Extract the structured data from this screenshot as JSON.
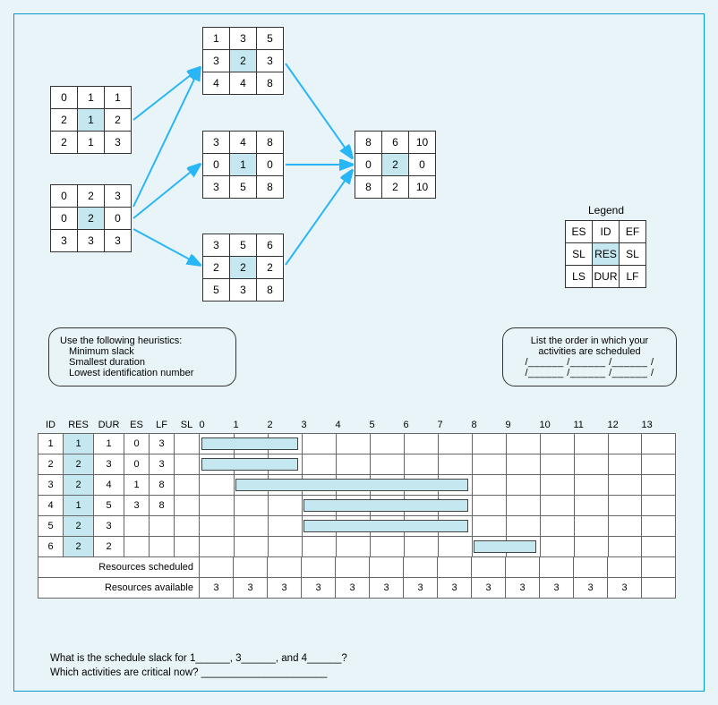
{
  "nodes": {
    "a1": {
      "es": "0",
      "id": "1",
      "ef": "1",
      "sl1": "2",
      "res": "1",
      "sl2": "2",
      "ls": "2",
      "dur": "1",
      "lf": "3"
    },
    "a2": {
      "es": "0",
      "id": "2",
      "ef": "3",
      "sl1": "0",
      "res": "2",
      "sl2": "0",
      "ls": "3",
      "dur": "3",
      "lf": "3"
    },
    "a3": {
      "es": "1",
      "id": "3",
      "ef": "5",
      "sl1": "3",
      "res": "2",
      "sl2": "3",
      "ls": "4",
      "dur": "4",
      "lf": "8"
    },
    "a4": {
      "es": "3",
      "id": "4",
      "ef": "8",
      "sl1": "0",
      "res": "1",
      "sl2": "0",
      "ls": "3",
      "dur": "5",
      "lf": "8"
    },
    "a5": {
      "es": "3",
      "id": "5",
      "ef": "6",
      "sl1": "2",
      "res": "2",
      "sl2": "2",
      "ls": "5",
      "dur": "3",
      "lf": "8"
    },
    "a6": {
      "es": "8",
      "id": "6",
      "ef": "10",
      "sl1": "0",
      "res": "2",
      "sl2": "0",
      "ls": "8",
      "dur": "2",
      "lf": "10"
    }
  },
  "legend": {
    "title": "Legend",
    "es": "ES",
    "id": "ID",
    "ef": "EF",
    "sl": "SL",
    "res": "RES",
    "sl2": "SL",
    "ls": "LS",
    "dur": "DUR",
    "lf": "LF"
  },
  "heuristics": {
    "title": "Use the following heuristics:",
    "h1": "Minimum slack",
    "h2": "Smallest duration",
    "h3": "Lowest identification number"
  },
  "order": {
    "title1": "List the order in which your",
    "title2": "activities are scheduled",
    "line1": "/______ /______ /______ /",
    "line2": "/______ /______ /______ /"
  },
  "gantt": {
    "headers": {
      "id": "ID",
      "res": "RES",
      "dur": "DUR",
      "es": "ES",
      "lf": "LF",
      "sl": "SL"
    },
    "times": [
      "0",
      "1",
      "2",
      "3",
      "4",
      "5",
      "6",
      "7",
      "8",
      "9",
      "10",
      "11",
      "12",
      "13"
    ],
    "rows": [
      {
        "id": "1",
        "res": "1",
        "dur": "1",
        "es": "0",
        "lf": "3",
        "sl": "",
        "bar_start": 0,
        "bar_end": 3
      },
      {
        "id": "2",
        "res": "2",
        "dur": "3",
        "es": "0",
        "lf": "3",
        "sl": "",
        "bar_start": 0,
        "bar_end": 3
      },
      {
        "id": "3",
        "res": "2",
        "dur": "4",
        "es": "1",
        "lf": "8",
        "sl": "",
        "bar_start": 1,
        "bar_end": 8
      },
      {
        "id": "4",
        "res": "1",
        "dur": "5",
        "es": "3",
        "lf": "8",
        "sl": "",
        "bar_start": 3,
        "bar_end": 8
      },
      {
        "id": "5",
        "res": "2",
        "dur": "3",
        "es": "",
        "lf": "",
        "sl": "",
        "bar_start": 3,
        "bar_end": 8
      },
      {
        "id": "6",
        "res": "2",
        "dur": "2",
        "es": "",
        "lf": "",
        "sl": "",
        "bar_start": 8,
        "bar_end": 10
      }
    ],
    "sched_label": "Resources scheduled",
    "avail_label": "Resources available",
    "avail": [
      "3",
      "3",
      "3",
      "3",
      "3",
      "3",
      "3",
      "3",
      "3",
      "3",
      "3",
      "3",
      "3"
    ]
  },
  "questions": {
    "q1a": "What is the schedule slack for 1______, 3______, and 4______?",
    "q2": "Which activities are critical now? ______________________"
  },
  "chart_data": {
    "type": "table",
    "network": {
      "activities": [
        {
          "id": 1,
          "ES": 0,
          "EF": 1,
          "LS": 2,
          "LF": 3,
          "DUR": 1,
          "SL": 2,
          "RES": 1
        },
        {
          "id": 2,
          "ES": 0,
          "EF": 3,
          "LS": 3,
          "LF": 3,
          "DUR": 3,
          "SL": 0,
          "RES": 2
        },
        {
          "id": 3,
          "ES": 1,
          "EF": 5,
          "LS": 4,
          "LF": 8,
          "DUR": 4,
          "SL": 3,
          "RES": 2
        },
        {
          "id": 4,
          "ES": 3,
          "EF": 8,
          "LS": 3,
          "LF": 8,
          "DUR": 5,
          "SL": 0,
          "RES": 1
        },
        {
          "id": 5,
          "ES": 3,
          "EF": 6,
          "LS": 5,
          "LF": 8,
          "DUR": 3,
          "SL": 2,
          "RES": 2
        },
        {
          "id": 6,
          "ES": 8,
          "EF": 10,
          "LS": 8,
          "LF": 10,
          "DUR": 2,
          "SL": 0,
          "RES": 2
        }
      ],
      "edges": [
        [
          1,
          3
        ],
        [
          2,
          3
        ],
        [
          2,
          4
        ],
        [
          2,
          5
        ],
        [
          3,
          6
        ],
        [
          4,
          6
        ],
        [
          5,
          6
        ]
      ]
    },
    "gantt_bars": [
      {
        "id": 1,
        "start": 0,
        "end": 3
      },
      {
        "id": 2,
        "start": 0,
        "end": 3
      },
      {
        "id": 3,
        "start": 1,
        "end": 8
      },
      {
        "id": 4,
        "start": 3,
        "end": 8
      },
      {
        "id": 5,
        "start": 3,
        "end": 8
      },
      {
        "id": 6,
        "start": 8,
        "end": 10
      }
    ],
    "resources_available_per_period": 3,
    "periods": 13
  }
}
